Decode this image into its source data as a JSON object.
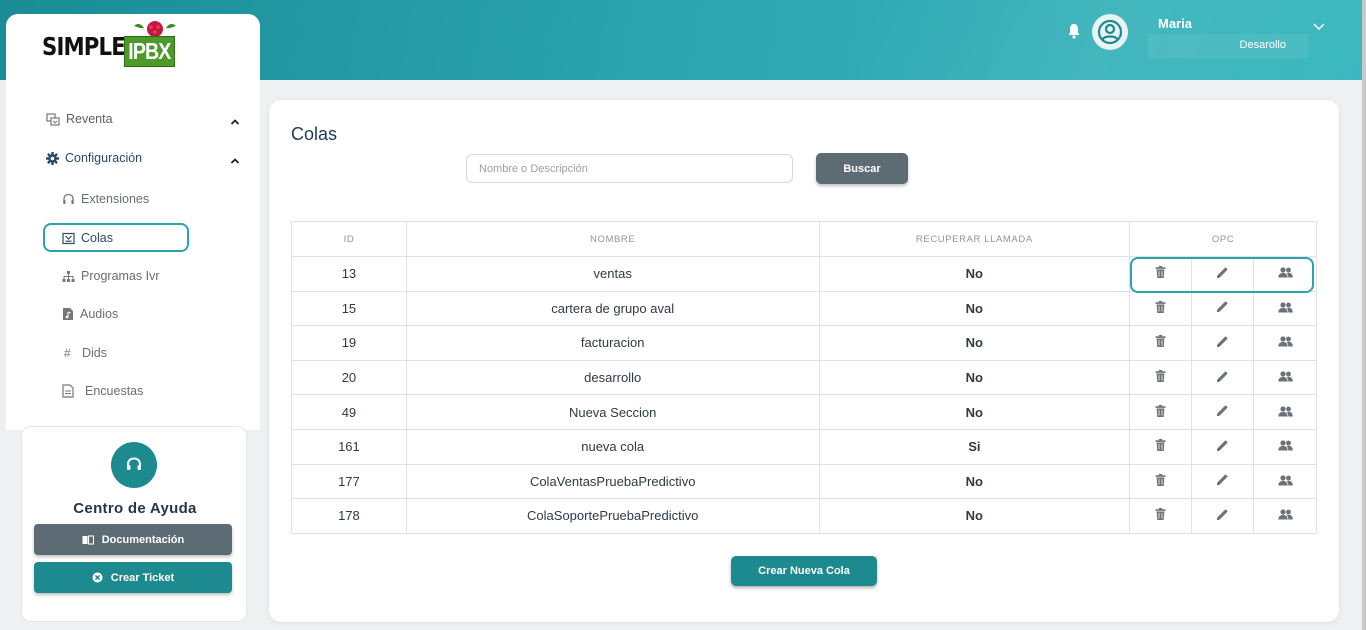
{
  "header": {
    "user_name": "Maria",
    "user_role": "Desarollo"
  },
  "logo": {
    "word1": "SIMPLE",
    "word2": "IPBX"
  },
  "sidebar": {
    "items": [
      {
        "label": "Reventa",
        "icon": "reventa-icon"
      },
      {
        "label": "Configuración",
        "icon": "gear-icon"
      },
      {
        "label": "Extensiones",
        "icon": "headset-icon"
      },
      {
        "label": "Colas",
        "icon": "queue-icon"
      },
      {
        "label": "Programas Ivr",
        "icon": "sitemap-icon"
      },
      {
        "label": "Audios",
        "icon": "audio-file-icon"
      },
      {
        "label": "Dids",
        "icon": "hash-icon"
      },
      {
        "label": "Encuestas",
        "icon": "survey-icon"
      }
    ]
  },
  "help": {
    "title": "Centro de Ayuda",
    "doc_label": "Documentación",
    "ticket_label": "Crear Ticket"
  },
  "main": {
    "title": "Colas",
    "search_placeholder": "Nombre o Descripción",
    "search_button": "Buscar",
    "create_button": "Crear Nueva Cola",
    "columns": [
      "ID",
      "NOMBRE",
      "RECUPERAR LLAMADA",
      "OPC"
    ],
    "rows": [
      {
        "id": "13",
        "nombre": "ventas",
        "recuperar": "No"
      },
      {
        "id": "15",
        "nombre": "cartera de grupo aval",
        "recuperar": "No"
      },
      {
        "id": "19",
        "nombre": "facturacion",
        "recuperar": "No"
      },
      {
        "id": "20",
        "nombre": "desarrollo",
        "recuperar": "No"
      },
      {
        "id": "49",
        "nombre": "Nueva Seccion",
        "recuperar": "No"
      },
      {
        "id": "161",
        "nombre": "nueva cola",
        "recuperar": "Si"
      },
      {
        "id": "177",
        "nombre": "ColaVentasPruebaPredictivo",
        "recuperar": "No"
      },
      {
        "id": "178",
        "nombre": "ColaSoportePruebaPredictivo",
        "recuperar": "No"
      }
    ]
  },
  "colors": {
    "accent": "#1c8a8e",
    "header_gradient_start": "#1a8c96",
    "header_gradient_end": "#3bb8bf",
    "secondary_button": "#5d6b74",
    "highlight_outline": "#2aa3ad"
  }
}
